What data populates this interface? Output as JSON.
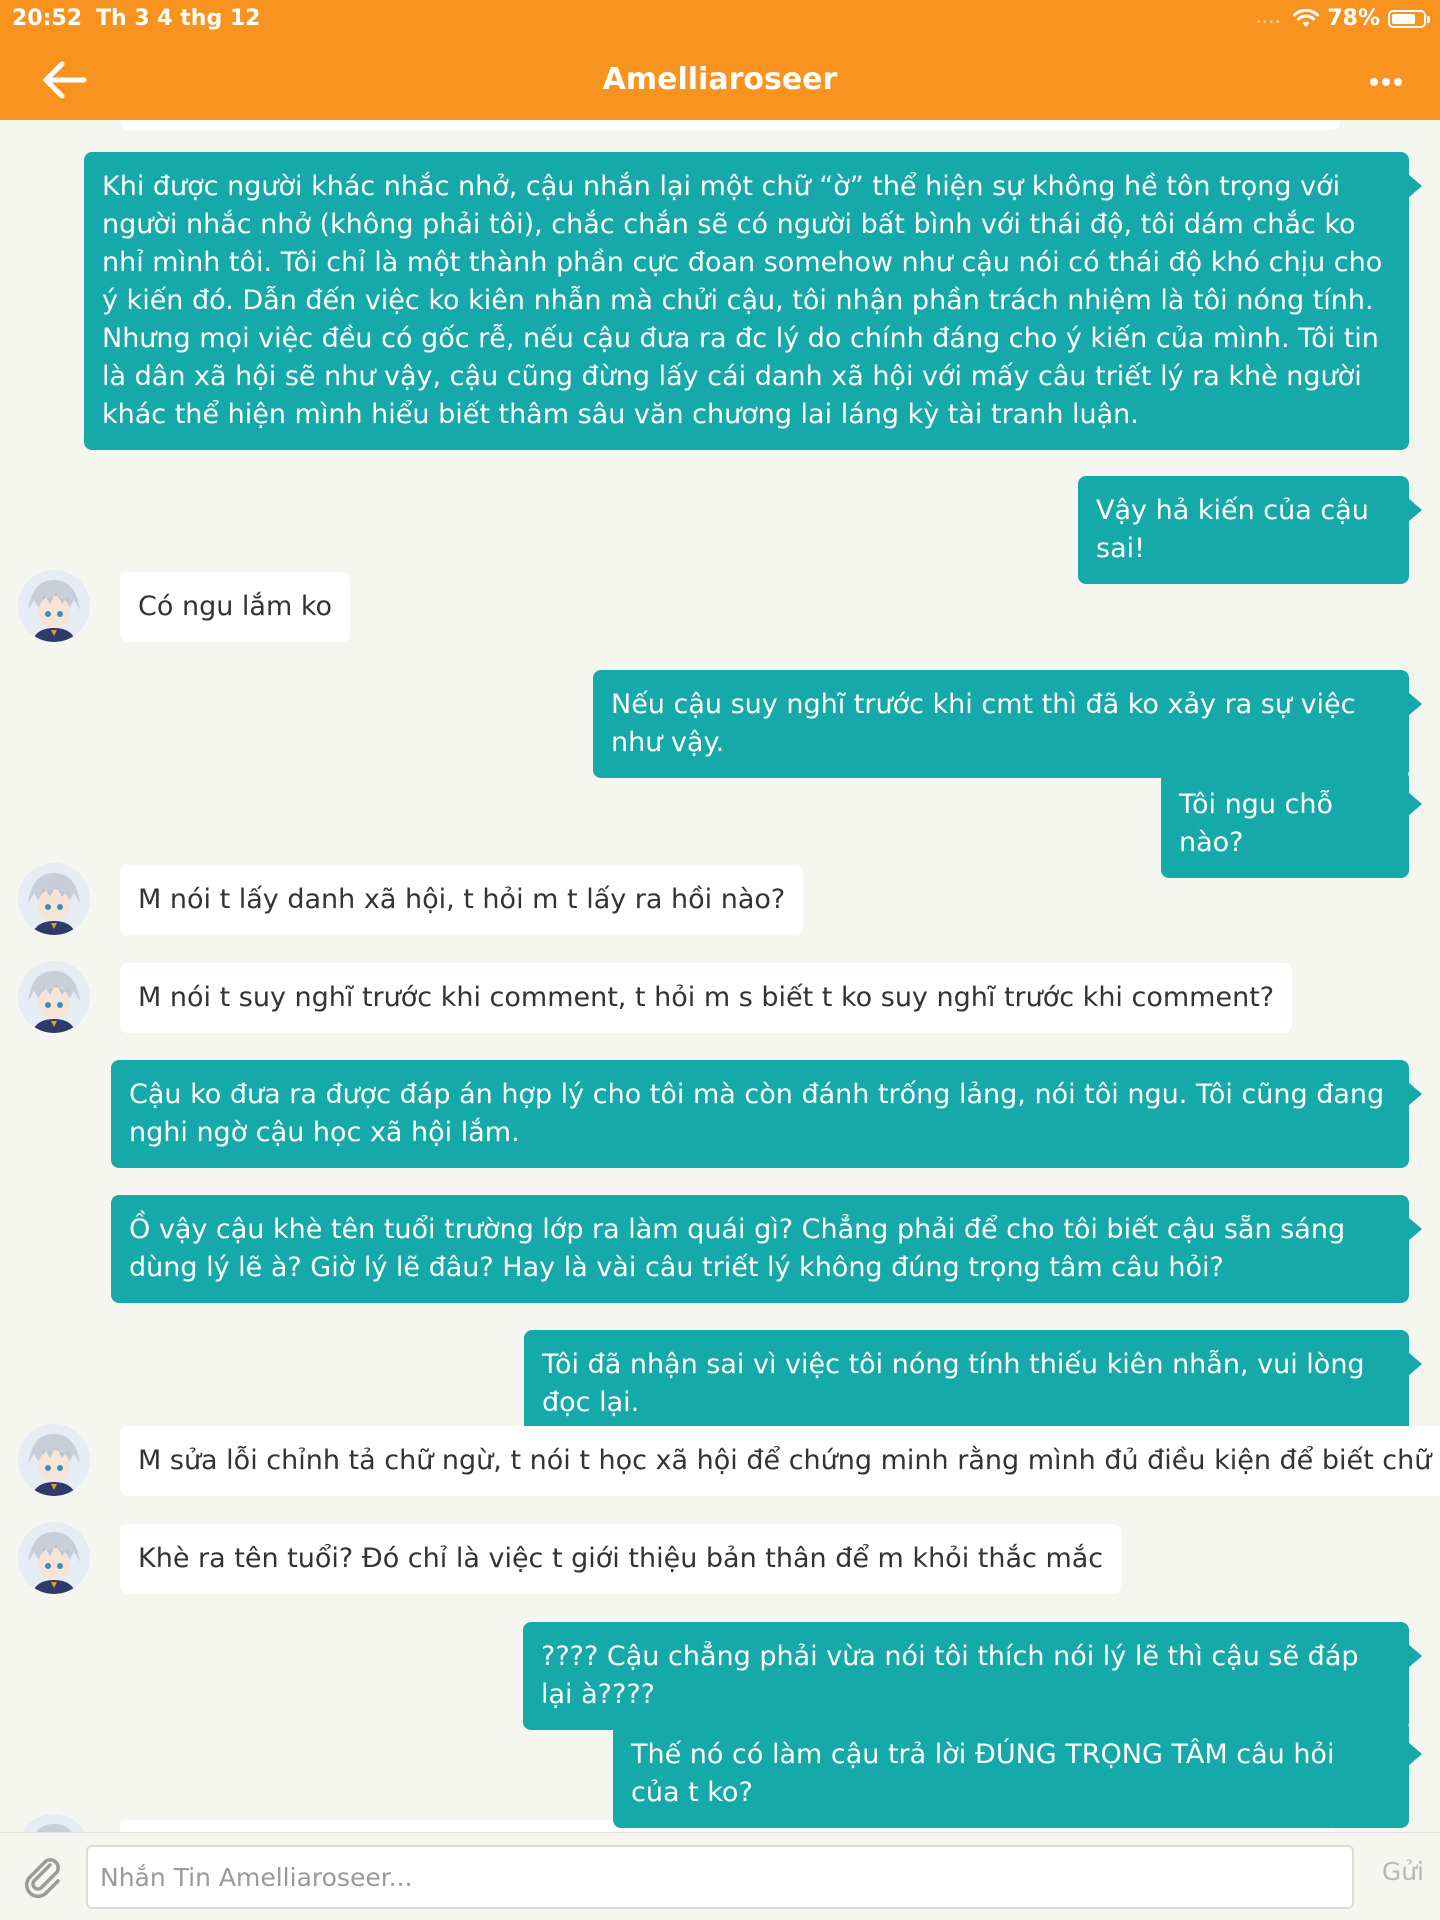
{
  "status_bar": {
    "time": "20:52",
    "date": "Th 3 4 thg 12",
    "signal": "....",
    "battery": "78%",
    "battery_level": 0.78
  },
  "header": {
    "title": "Amelliaroseer"
  },
  "colors": {
    "brand": "#f7931e",
    "outgoing_bubble": "#16a9a9",
    "incoming_bubble": "#ffffff",
    "background": "#f6f6f1"
  },
  "messages": [
    {
      "direction": "out",
      "text": "Khi được người khác nhắc nhở, cậu nhắn lại một chữ “ờ” thể hiện sự không hề tôn trọng với người nhắc nhở (không phải tôi), chắc chắn sẽ có người bất bình với thái độ, tôi dám chắc ko nhỉ mình tôi. Tôi chỉ là một thành phần cực đoan somehow như cậu nói có thái độ khó chịu cho ý kiến đó. Dẫn đến việc ko kiên nhẫn mà chửi cậu, tôi nhận phần trách nhiệm là tôi nóng tính. Nhưng mọi việc đều có gốc rễ, nếu cậu đưa ra đc lý do chính đáng cho ý kiến của mình. Tôi tin là dân xã hội sẽ như vậy, cậu cũng đừng lấy cái danh xã hội với mấy câu triết lý ra khè người khác thể hiện mình hiểu biết thâm sâu văn chương lai láng kỳ tài tranh luận."
    },
    {
      "direction": "out",
      "text": "Vậy hả kiến của cậu sai!"
    },
    {
      "direction": "in",
      "text": "Có ngu lắm ko"
    },
    {
      "direction": "out",
      "text": "Nếu cậu suy nghĩ trước khi cmt thì đã ko xảy ra sự việc như vậy."
    },
    {
      "direction": "out",
      "text": "Tôi ngu chỗ nào?"
    },
    {
      "direction": "in",
      "text": "M nói t lấy danh xã hội, t hỏi m t lấy ra hồi nào?"
    },
    {
      "direction": "in",
      "text": "M nói t suy nghĩ trước khi comment, t hỏi m s biết t ko suy nghĩ trước khi comment?"
    },
    {
      "direction": "out",
      "text": "Cậu ko đưa ra được đáp án hợp lý cho tôi mà còn đánh trống lảng, nói tôi ngu. Tôi cũng đang nghi ngờ cậu học xã hội lắm."
    },
    {
      "direction": "out",
      "text": "Ồ vậy cậu khè tên tuổi trường lớp ra làm quái gì? Chẳng phải để cho tôi biết cậu sẵn sáng dùng lý lẽ à? Giờ lý lẽ đâu? Hay là vài câu triết lý không đúng trọng tâm câu hỏi?"
    },
    {
      "direction": "out",
      "text": "Tôi đã nhận sai vì việc tôi nóng tính thiếu kiên nhẫn, vui lòng đọc lại."
    },
    {
      "direction": "in",
      "text": "M sửa lỗi chỉnh tả chữ ngừ, t nói t học xã hội để chứng minh rằng mình đủ điều kiện để biết chữ"
    },
    {
      "direction": "in",
      "text": "Khè ra tên tuổi? Đó chỉ là việc t giới thiệu bản thân để m khỏi thắc mắc"
    },
    {
      "direction": "out",
      "text": "???? Cậu chẳng phải vừa nói tôi thích nói lý lẽ thì cậu sẽ đáp lại à????"
    },
    {
      "direction": "out",
      "text": "Thế nó có làm cậu trả lời ĐÚNG TRỌNG TÂM câu hỏi của t ko?"
    }
  ],
  "composer": {
    "placeholder": "Nhắn Tin Amelliaroseer...",
    "value": "",
    "send_label": "Gửi"
  },
  "icons": {
    "back": "arrow-left-icon",
    "more": "more-dots-icon",
    "attach": "paperclip-icon",
    "wifi": "wifi-icon",
    "battery": "battery-icon",
    "avatar": "anime-avatar"
  }
}
